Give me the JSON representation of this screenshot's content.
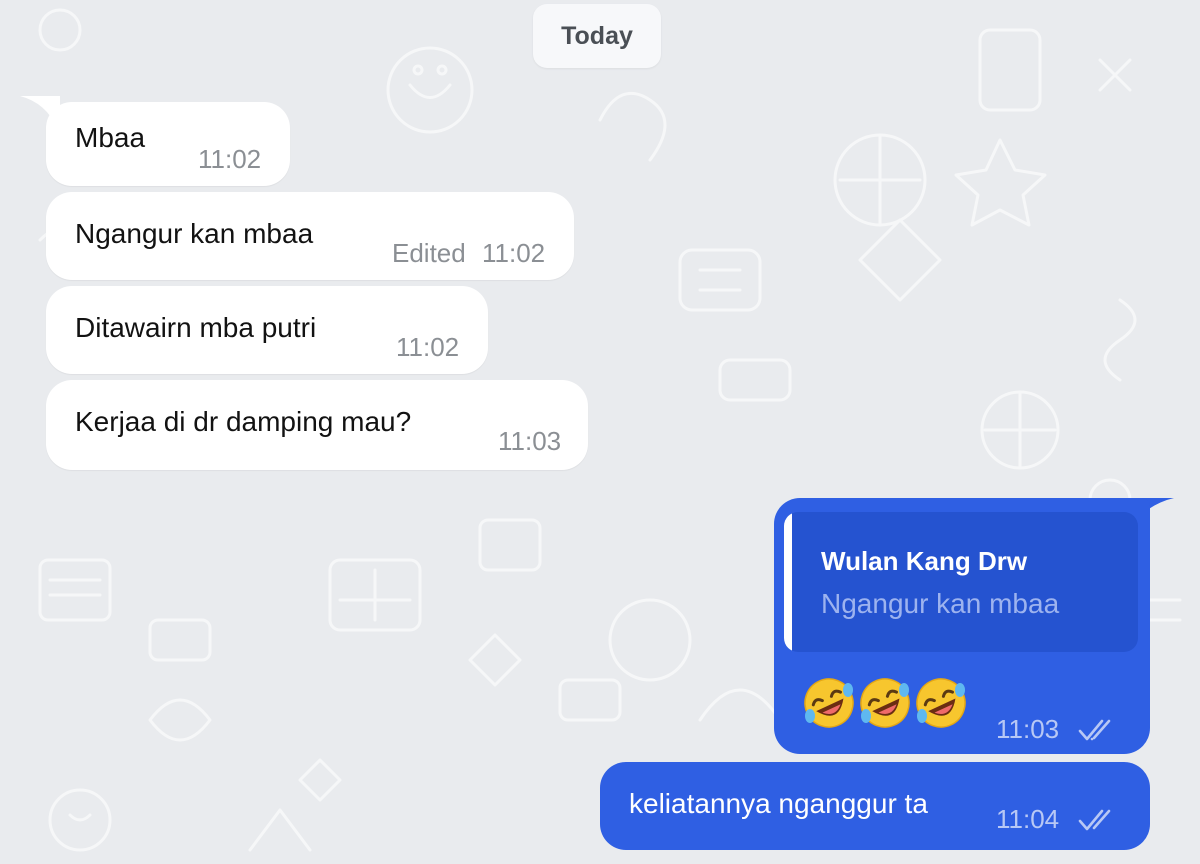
{
  "date_separator": "Today",
  "messages": [
    {
      "direction": "in",
      "text": "Mbaa",
      "edited_label": "",
      "time": "11:02"
    },
    {
      "direction": "in",
      "text": "Ngangur kan mbaa",
      "edited_label": "Edited",
      "time": "11:02"
    },
    {
      "direction": "in",
      "text": "Ditawairn mba putri",
      "edited_label": "",
      "time": "11:02"
    },
    {
      "direction": "in",
      "text": "Kerjaa di dr damping mau?",
      "edited_label": "",
      "time": "11:03"
    },
    {
      "direction": "out",
      "reply_to": {
        "sender": "Wulan Kang Drw",
        "text": "Ngangur kan mbaa"
      },
      "emoji": [
        "rolling-on-floor-laughing-emoji",
        "rolling-on-floor-laughing-emoji",
        "rolling-on-floor-laughing-emoji"
      ],
      "time": "11:03",
      "status_icon": "double-check-icon"
    },
    {
      "direction": "out",
      "text": "keliatannya nganggur ta",
      "time": "11:04",
      "status_icon": "double-check-icon"
    }
  ],
  "colors": {
    "wallpaper": "#e9ebee",
    "incoming_bubble": "#ffffff",
    "outgoing_bubble": "#2f5fe3",
    "reply_quote": "#2553d0",
    "meta_text": "#8b8f94"
  }
}
